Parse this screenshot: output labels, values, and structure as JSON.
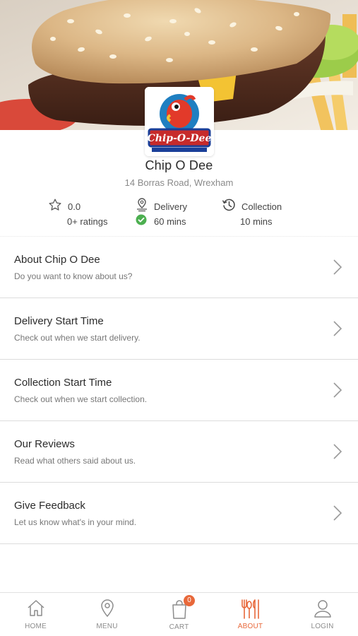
{
  "restaurant": {
    "name": "Chip O Dee",
    "address": "14 Borras Road, Wrexham",
    "logo_text": "Chip-O-Dee",
    "logo_tagline": "Fish & Chips"
  },
  "stats": {
    "rating_value": "0.0",
    "rating_count": "0+ ratings",
    "delivery_label": "Delivery",
    "delivery_time": "60 mins",
    "collection_label": "Collection",
    "collection_time": "10 mins"
  },
  "menu_items": [
    {
      "title": "About Chip O Dee",
      "subtitle": "Do you want to know about us?"
    },
    {
      "title": "Delivery Start Time",
      "subtitle": "Check out when we start delivery."
    },
    {
      "title": "Collection Start Time",
      "subtitle": "Check out when we start collection."
    },
    {
      "title": "Our Reviews",
      "subtitle": "Read what others said about us."
    },
    {
      "title": "Give Feedback",
      "subtitle": "Let us know what's in your mind."
    }
  ],
  "bottom_nav": {
    "home": "HOME",
    "menu": "MENU",
    "cart": "CART",
    "about": "ABOUT",
    "login": "LOGIN",
    "cart_count": "0",
    "active": "about"
  },
  "colors": {
    "accent": "#e8683a",
    "check_green": "#4caf50"
  }
}
